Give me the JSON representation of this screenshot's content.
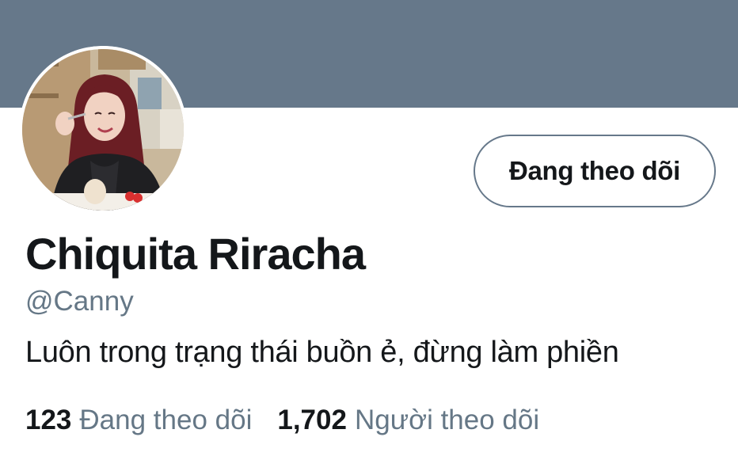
{
  "profile": {
    "display_name": "Chiquita Riracha",
    "handle": "@Canny",
    "bio": "Luôn trong trạng thái buồn ẻ, đừng làm phiền",
    "follow_button_label": "Đang theo dõi",
    "avatar": "profile-photo"
  },
  "stats": {
    "following_count": "123",
    "following_label": "Đang theo dõi",
    "followers_count": "1,702",
    "followers_label": "Người theo dõi"
  },
  "colors": {
    "banner": "#66788a",
    "primary_text": "#14171a",
    "secondary_text": "#657786"
  }
}
